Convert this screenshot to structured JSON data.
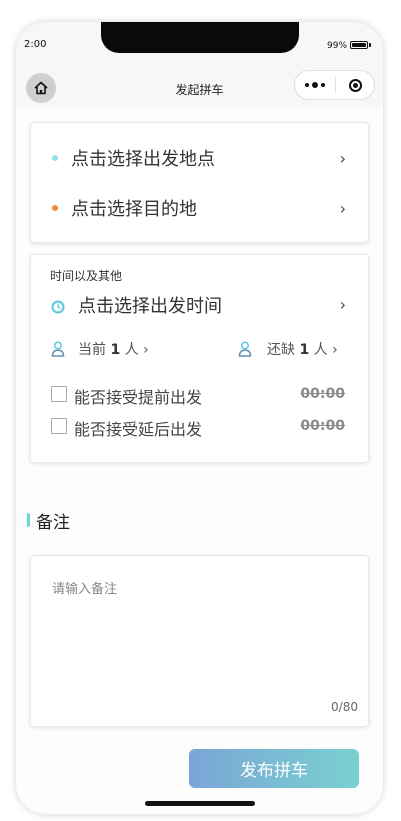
{
  "status": {
    "time": "2:00",
    "battery_pct": "99%"
  },
  "nav": {
    "title": "发起拼车"
  },
  "route": {
    "departure": "点击选择出发地点",
    "destination": "点击选择目的地",
    "departure_dot_color": "#8fe1ee",
    "destination_dot_color": "#f08a3a"
  },
  "details": {
    "section_label": "时间以及其他",
    "time_placeholder": "点击选择出发时间",
    "current": {
      "prefix": "当前",
      "count": "1",
      "suffix": "人"
    },
    "missing": {
      "prefix": "还缺",
      "count": "1",
      "suffix": "人"
    },
    "options": [
      {
        "label": "能否接受提前出发",
        "time": "00:00"
      },
      {
        "label": "能否接受延后出发",
        "time": "00:00"
      }
    ]
  },
  "note": {
    "title": "备注",
    "placeholder": "请输入备注",
    "count": "0/80"
  },
  "publish": {
    "label": "发布拼车"
  },
  "colors": {
    "accent_gradient_start": "#7aa6d6",
    "accent_gradient_end": "#7ad0d1",
    "note_bar": "#6fd3e0"
  }
}
